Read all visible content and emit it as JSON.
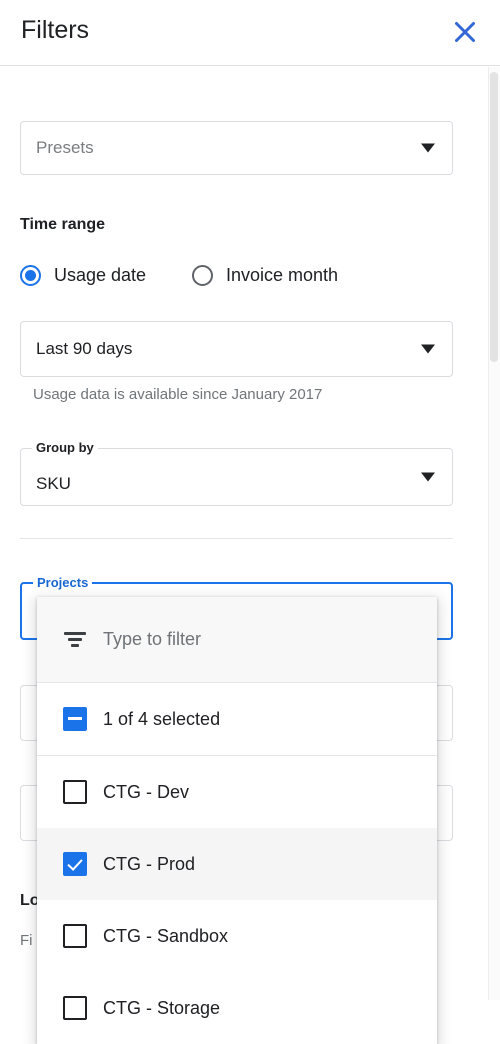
{
  "header": {
    "title": "Filters",
    "close_icon": "close-icon",
    "close_color": "#1a73e8"
  },
  "presets": {
    "placeholder": "Presets",
    "caret_icon": "chevron-down-icon"
  },
  "time_range": {
    "label": "Time range",
    "options": [
      {
        "label": "Usage date",
        "selected": true
      },
      {
        "label": "Invoice month",
        "selected": false
      }
    ],
    "range_value": "Last 90 days",
    "hint": "Usage data is available since January 2017"
  },
  "group_by": {
    "label": "Group by",
    "value": "SKU"
  },
  "projects": {
    "label": "Projects",
    "focused": true,
    "accent_color": "#1a73e8"
  },
  "dropdown": {
    "filter_icon": "filter-icon",
    "search_placeholder": "Type to filter",
    "select_all_label": "1 of 4 selected",
    "select_all_state": "indeterminate",
    "options": [
      {
        "label": "CTG - Dev",
        "checked": false,
        "highlighted": false
      },
      {
        "label": "CTG - Prod",
        "checked": true,
        "highlighted": true
      },
      {
        "label": "CTG - Sandbox",
        "checked": false,
        "highlighted": false
      },
      {
        "label": "CTG - Storage",
        "checked": false,
        "highlighted": false
      }
    ]
  },
  "background": {
    "locations_label": "Lo",
    "locations_hint": "Fi"
  }
}
